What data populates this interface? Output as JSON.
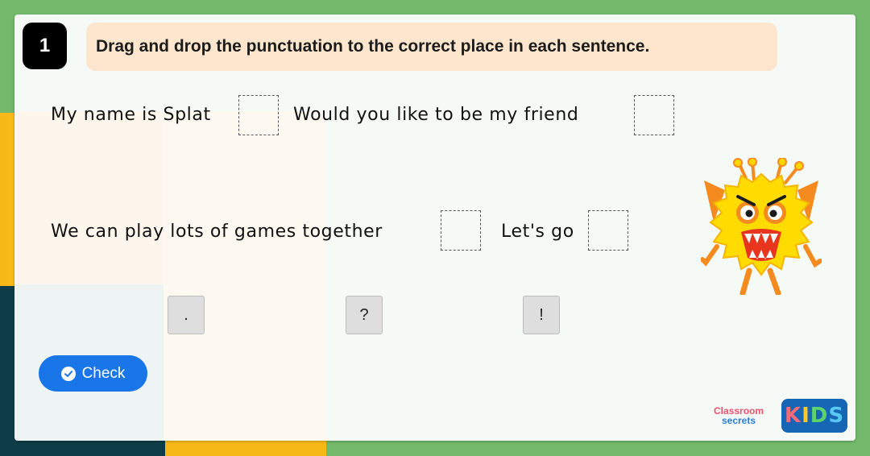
{
  "question": {
    "number": "1",
    "instruction": "Drag and drop the punctuation to the correct place in each sentence."
  },
  "sentences": [
    {
      "part1": "My name is Splat",
      "part2": "Would you like to be my friend"
    },
    {
      "part1": "We can play lots of games together",
      "part2": "Let's go"
    }
  ],
  "tiles": [
    ".",
    "?",
    "!"
  ],
  "check_button": {
    "label": "Check",
    "icon": "check-circle-icon"
  },
  "logos": {
    "classroom_line1": "Classroom",
    "classroom_line2": "secrets",
    "kids_letters": [
      "K",
      "I",
      "D",
      "S"
    ],
    "kids_colors": [
      "#f26b7a",
      "#ffc828",
      "#5fd36b",
      "#59c8f0"
    ]
  },
  "illustration": "monster-character",
  "colors": {
    "background_green": "#72b96b",
    "accent_yellow": "#f7b918",
    "dark_teal": "#0f3d47",
    "instruction_bg": "#fde6cd",
    "check_blue": "#1976e8",
    "tile_gray": "#dedede"
  }
}
